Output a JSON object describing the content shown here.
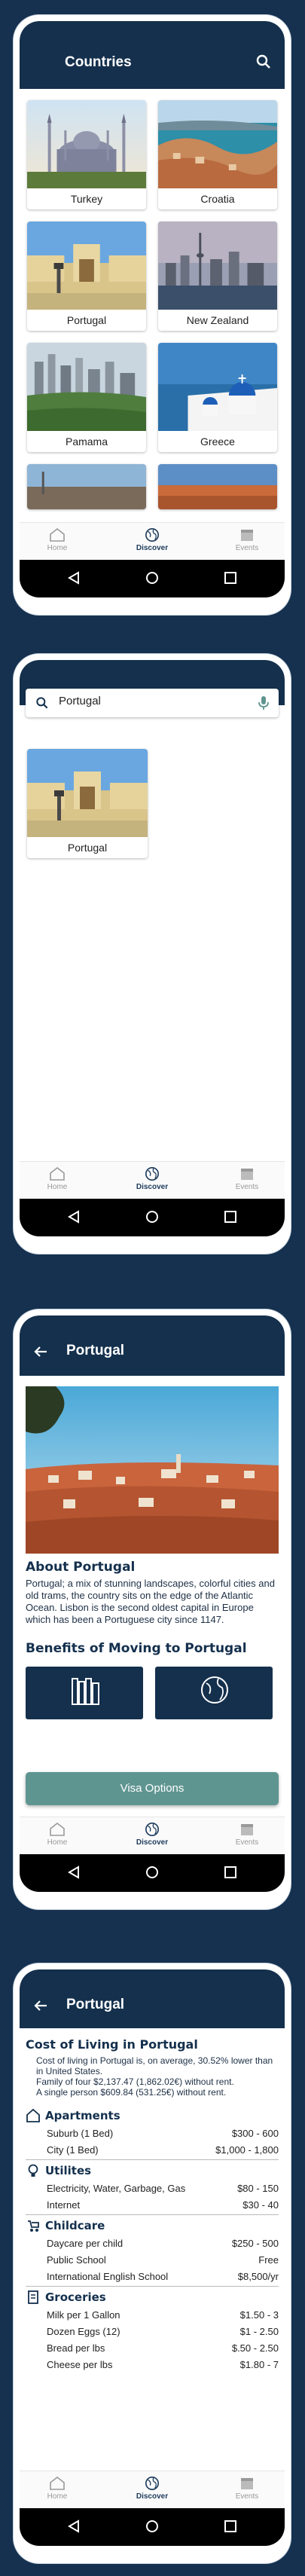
{
  "screen1": {
    "title": "Countries",
    "countries": [
      "Turkey",
      "Croatia",
      "Portugal",
      "New Zealand",
      "Pamama",
      "Greece"
    ]
  },
  "screen2": {
    "search_value": "Portugal",
    "result": "Portugal"
  },
  "screen3": {
    "title": "Portugal",
    "about_title": "About Portugal",
    "about_text": "Portugal; a mix of stunning landscapes, colorful cities and old trams, the country sits on the edge of the Atlantic Ocean. Lisbon is the second oldest capital in Europe which has been a Portuguese city since 1147.",
    "benefits_title": "Benefits of Moving to Portugal",
    "visa_button": "Visa Options"
  },
  "screen4": {
    "title": "Portugal",
    "cost_title": "Cost of Living in Portugal",
    "intro_1": "Cost of living in Portugal is, on average, 30.52% lower than in United States.",
    "intro_2": "Family of four $2,137.47 (1,862.02€) without rent.",
    "intro_3": "A single person $609.84 (531.25€) without rent.",
    "sections": [
      {
        "name": "Apartments",
        "rows": [
          [
            "Suburb (1 Bed)",
            "$300 - 600"
          ],
          [
            "City (1 Bed)",
            "$1,000 - 1,800"
          ]
        ]
      },
      {
        "name": "Utilites",
        "rows": [
          [
            "Electricity, Water, Garbage, Gas",
            "$80 - 150"
          ],
          [
            "Internet",
            "$30 - 40"
          ]
        ]
      },
      {
        "name": "Childcare",
        "rows": [
          [
            "Daycare per child",
            "$250 - 500"
          ],
          [
            "Public School",
            "Free"
          ],
          [
            "International English School",
            "$8,500/yr"
          ]
        ]
      },
      {
        "name": "Groceries",
        "rows": [
          [
            "Milk per 1 Gallon",
            "$1.50 - 3"
          ],
          [
            "Dozen Eggs (12)",
            "$1 - 2.50"
          ],
          [
            "Bread per lbs",
            "$.50 - 2.50"
          ],
          [
            "Cheese per lbs",
            "$1.80 - 7"
          ]
        ]
      }
    ]
  },
  "nav": {
    "home": "Home",
    "discover": "Discover",
    "events": "Events"
  },
  "colors": {
    "appbar": "#14304d",
    "background": "#15314f",
    "accent": "#5f9591"
  }
}
